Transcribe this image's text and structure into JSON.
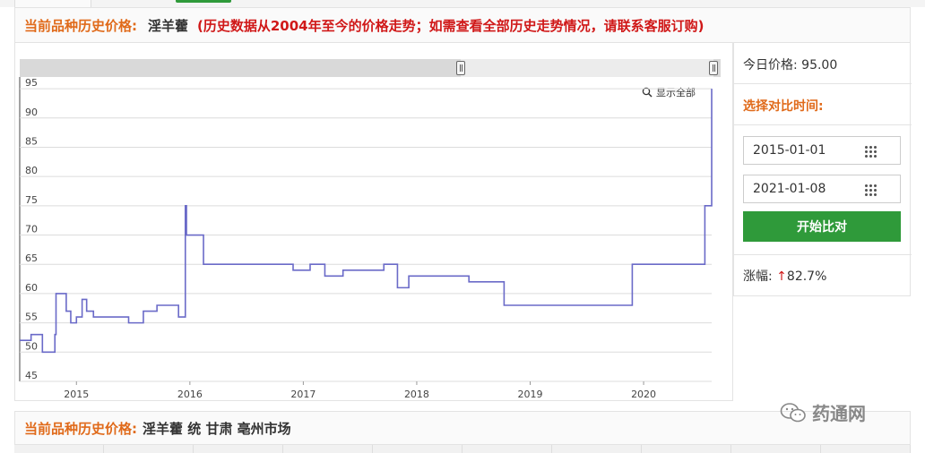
{
  "header": {
    "label": "当前品种历史价格:",
    "product": "淫羊藿",
    "note": "(历史数据从2004年至今的价格走势；如需查看全部历史走势情况，请联系客服订购)"
  },
  "chart": {
    "show_all": "显示全部",
    "icon": "zoom-icon"
  },
  "chart_data": {
    "type": "line",
    "step": true,
    "ylim": [
      45,
      97
    ],
    "yticks": [
      45,
      50,
      55,
      60,
      65,
      70,
      75,
      80,
      85,
      90,
      95
    ],
    "xticks": [
      "2015",
      "2016",
      "2017",
      "2018",
      "2019",
      "2020"
    ],
    "xlim": [
      2014.5,
      2020.6
    ],
    "grid": true,
    "series": [
      {
        "color": "#6a6ac8",
        "points": [
          [
            2014.5,
            52
          ],
          [
            2014.6,
            53
          ],
          [
            2014.7,
            50
          ],
          [
            2014.81,
            53
          ],
          [
            2014.82,
            60
          ],
          [
            2014.91,
            57
          ],
          [
            2014.95,
            55
          ],
          [
            2015.0,
            56
          ],
          [
            2015.05,
            59
          ],
          [
            2015.09,
            57
          ],
          [
            2015.15,
            56
          ],
          [
            2015.46,
            55
          ],
          [
            2015.59,
            57
          ],
          [
            2015.71,
            58
          ],
          [
            2015.9,
            56
          ],
          [
            2015.96,
            75
          ],
          [
            2015.97,
            70
          ],
          [
            2016.12,
            65
          ],
          [
            2016.91,
            64
          ],
          [
            2017.06,
            65
          ],
          [
            2017.19,
            63
          ],
          [
            2017.35,
            64
          ],
          [
            2017.71,
            65
          ],
          [
            2017.83,
            61
          ],
          [
            2017.93,
            63
          ],
          [
            2018.46,
            62
          ],
          [
            2018.77,
            58
          ],
          [
            2019.9,
            65
          ],
          [
            2020.54,
            75
          ],
          [
            2020.9,
            82
          ],
          [
            2020.95,
            95
          ],
          [
            2021.02,
            95
          ]
        ]
      }
    ]
  },
  "side": {
    "today_price_label": "今日价格:",
    "today_price_value": "95.00",
    "compare_label": "选择对比时间:",
    "date_start": "2015-01-01",
    "date_end": "2021-01-08",
    "start_button": "开始比对",
    "change_label": "涨幅:",
    "change_arrow": "↑",
    "change_value": "82.7%"
  },
  "sub_header": {
    "label": "当前品种历史价格:",
    "product": "淫羊藿 统 甘肃 亳州市场"
  },
  "watermark": {
    "text": "药通网",
    "icon": "wechat-icon"
  }
}
